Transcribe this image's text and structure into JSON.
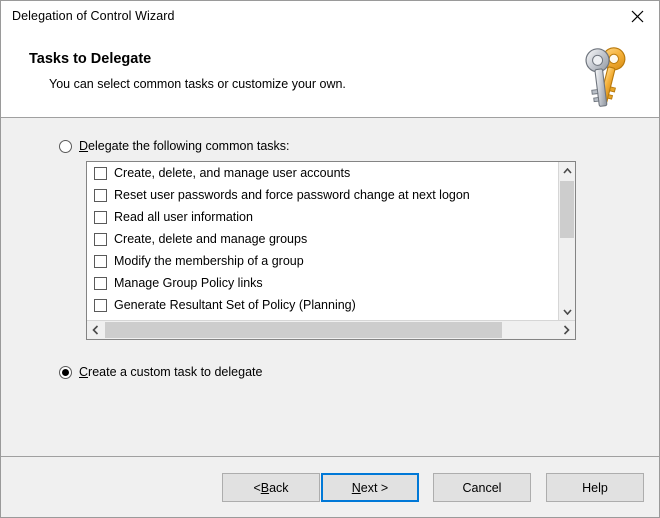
{
  "window": {
    "title": "Delegation of Control Wizard",
    "close_icon": "close-icon"
  },
  "header": {
    "title": "Tasks to Delegate",
    "subtitle": "You can select common tasks or customize your own.",
    "icon": "keys-icon"
  },
  "options": {
    "common": {
      "label_prefix": "",
      "label_accel": "D",
      "label_rest": "elegate the following common tasks:",
      "selected": false
    },
    "custom": {
      "label_accel": "C",
      "label_rest": "reate a custom task to delegate",
      "selected": true
    }
  },
  "task_list": {
    "items": [
      {
        "label": "Create, delete, and manage user accounts",
        "checked": false
      },
      {
        "label": "Reset user passwords and force password change at next logon",
        "checked": false
      },
      {
        "label": "Read all user information",
        "checked": false
      },
      {
        "label": "Create, delete and manage groups",
        "checked": false
      },
      {
        "label": "Modify the membership of a group",
        "checked": false
      },
      {
        "label": "Manage Group Policy links",
        "checked": false
      },
      {
        "label": "Generate Resultant Set of Policy (Planning)",
        "checked": false
      }
    ],
    "vertical_scrollbar": {
      "up_icon": "chevron-up-icon",
      "down_icon": "chevron-down-icon"
    },
    "horizontal_scrollbar": {
      "left_icon": "chevron-left-icon",
      "right_icon": "chevron-right-icon"
    }
  },
  "footer": {
    "back": {
      "accel": "B",
      "before": "< ",
      "after": "ack"
    },
    "next": {
      "accel": "N",
      "before": "",
      "after": "ext >"
    },
    "cancel": {
      "label": "Cancel"
    },
    "help": {
      "label": "Help"
    },
    "default_button": "next"
  },
  "colors": {
    "accent": "#0078d7",
    "dialog_bg": "#f0f0f0",
    "header_bg": "#ffffff",
    "button_bg": "#e1e1e1",
    "scroll_thumb": "#cdcdcd"
  }
}
